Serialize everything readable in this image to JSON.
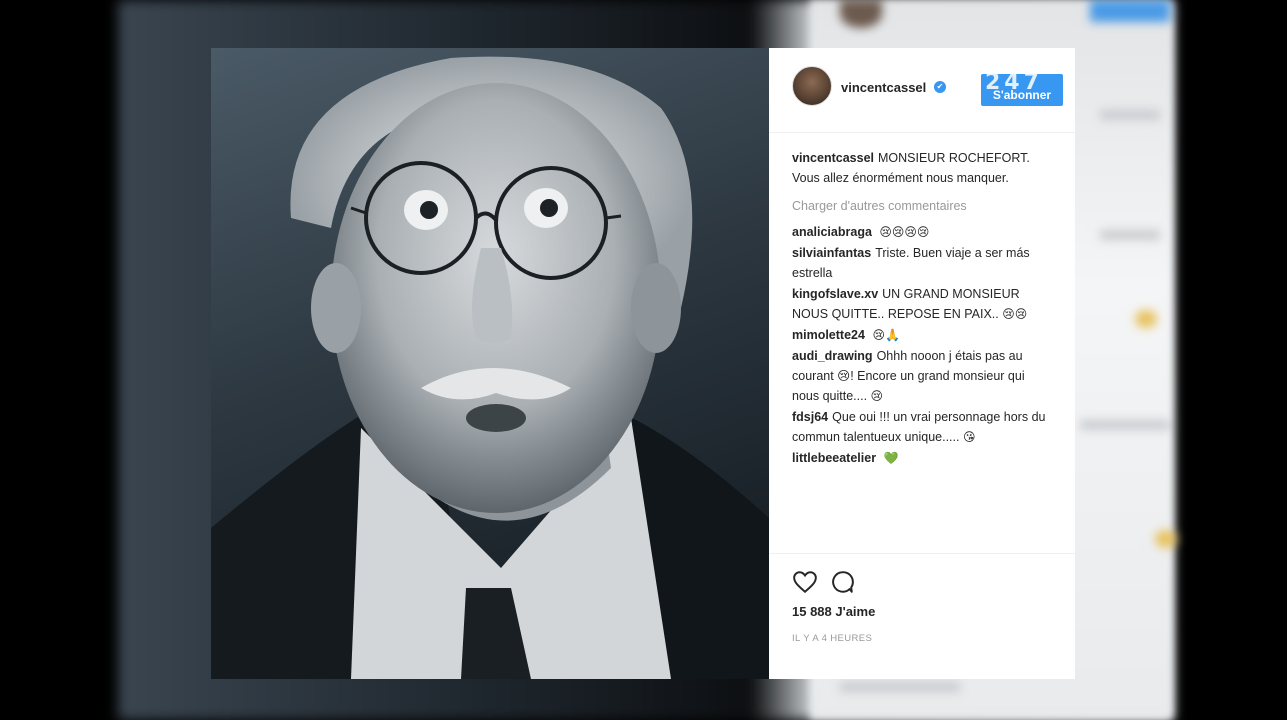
{
  "post": {
    "username": "vincentcassel",
    "verified_icon": "✔",
    "follow_label": "S'abonner",
    "follow_stamp": "247",
    "caption_user": "vincentcassel",
    "caption_text": "MONSIEUR ROCHEFORT. Vous allez énormément nous manquer.",
    "load_more": "Charger d'autres commentaires",
    "likes": "15 888 J'aime",
    "timestamp": "IL Y A 4 HEURES"
  },
  "comments": [
    {
      "user": "analiciabraga",
      "text": "",
      "emoji": "😢😢😢😢"
    },
    {
      "user": "silviainfantas",
      "text": "Triste. Buen viaje a ser más estrella",
      "emoji": ""
    },
    {
      "user": "kingofslave.xv",
      "text": "UN GRAND MONSIEUR NOUS QUITTE.. REPOSE EN PAIX..",
      "emoji": "😢😢"
    },
    {
      "user": "mimolette24",
      "text": "",
      "emoji": "😢🙏"
    },
    {
      "user": "audi_drawing",
      "text": "Ohhh nooon j étais pas au courant 😢! Encore un grand monsieur qui nous quitte....",
      "emoji": "😢"
    },
    {
      "user": "fdsj64",
      "text": "Que oui !!! un vrai personnage hors du commun talentueux unique.....",
      "emoji": "😘"
    },
    {
      "user": "littlebeeatelier",
      "text": "",
      "emoji": "💚"
    }
  ],
  "icons": {
    "like": "heart-icon",
    "comment": "comment-bubble-icon",
    "verified": "verified-badge-icon"
  },
  "colors": {
    "accent": "#3897f0",
    "text": "#262626",
    "muted": "#999999"
  }
}
